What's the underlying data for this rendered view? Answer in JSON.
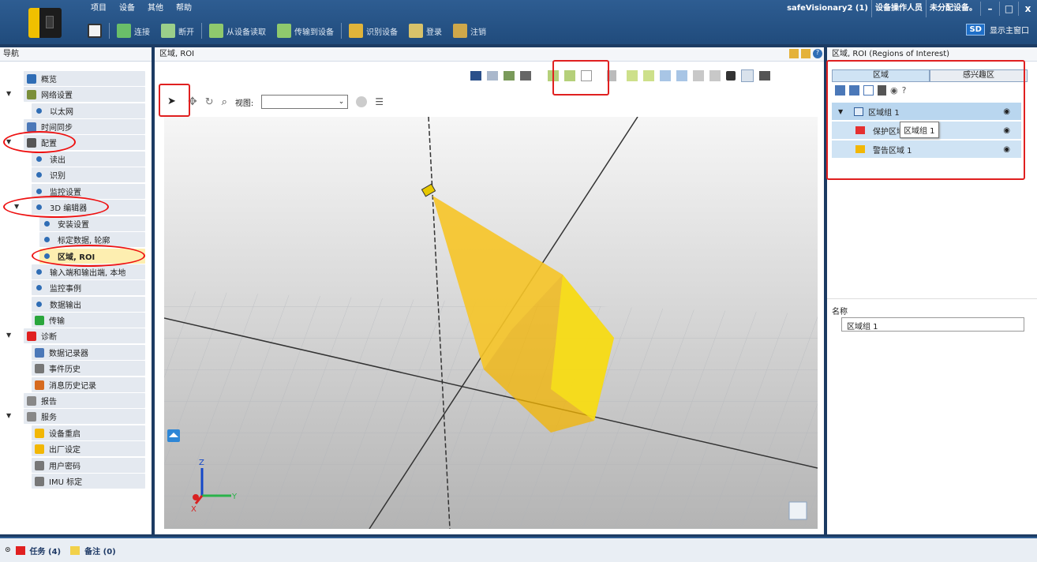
{
  "menu": [
    "项目",
    "设备",
    "其他",
    "帮助"
  ],
  "toolbar": {
    "connect": "连接",
    "disconnect": "断开",
    "read": "从设备读取",
    "transfer": "传输到设备",
    "identify": "识别设备",
    "login": "登录",
    "logout": "注销"
  },
  "user": {
    "device": "safeVisionary2 (1)",
    "role": "设备操作人员",
    "status": "未分配设备。"
  },
  "window_controls": {
    "minimize": "–",
    "restore": "□",
    "close": "x"
  },
  "show_main": {
    "badge": "SD",
    "label": "显示主窗口"
  },
  "nav": {
    "title": "导航",
    "items": [
      "概览",
      "网络设置",
      "以太网",
      "时间同步",
      "配置",
      "读出",
      "识别",
      "监控设置",
      "3D 编辑器",
      "安装设置",
      "标定数据, 轮廓",
      "区域, ROI",
      "输入端和输出端, 本地",
      "监控事例",
      "数据输出",
      "传输",
      "诊断",
      "数据记录器",
      "事件历史",
      "消息历史记录",
      "报告",
      "服务",
      "设备重启",
      "出厂设定",
      "用户密码",
      "IMU 标定"
    ]
  },
  "center": {
    "title": "区域, ROI",
    "view_label": "视图:",
    "view_value": ""
  },
  "right": {
    "title": "区域, ROI (Regions of Interest)",
    "tab_zones": "区域",
    "tab_roi": "感兴趣区",
    "zone_group": "区域组 1",
    "protect": "保护区域 1",
    "warn": "警告区域 1",
    "tooltip": "区域组 1",
    "name_label": "名称",
    "name_value": "区域组 1"
  },
  "bottom": {
    "tasks": "任务 (4)",
    "notes": "备注 (0)"
  },
  "axes": {
    "z": "Z",
    "x": "X",
    "y": "Y"
  }
}
